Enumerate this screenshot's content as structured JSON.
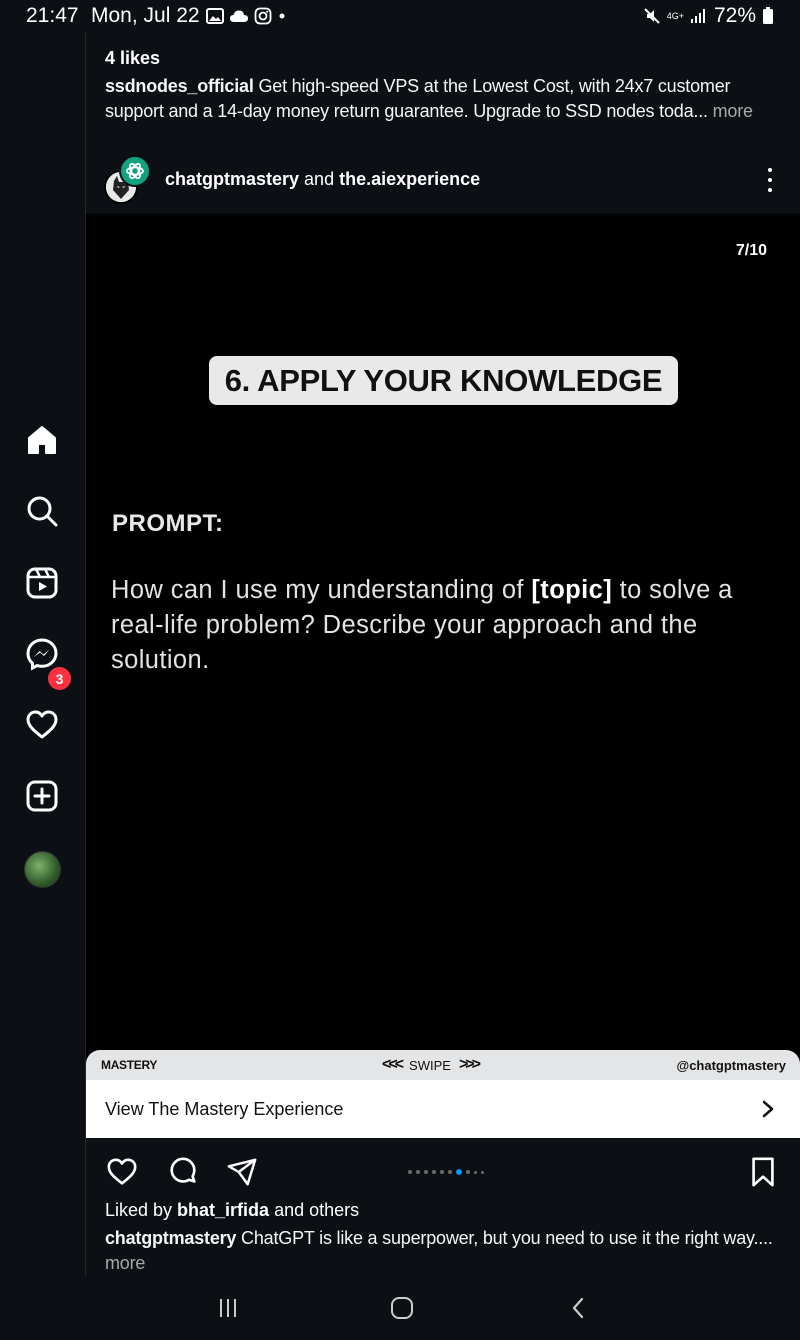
{
  "status_bar": {
    "time": "21:47",
    "date": "Mon, Jul 22",
    "network": "4G+",
    "battery": "72%"
  },
  "side_nav": {
    "items": [
      {
        "name": "home",
        "icon": "home-icon"
      },
      {
        "name": "search",
        "icon": "search-icon"
      },
      {
        "name": "reels",
        "icon": "reels-icon"
      },
      {
        "name": "messages",
        "icon": "messenger-icon"
      },
      {
        "name": "notifications",
        "icon": "heart-icon"
      },
      {
        "name": "create",
        "icon": "plus-square-icon"
      },
      {
        "name": "profile",
        "icon": "avatar"
      }
    ],
    "messages_badge": "3"
  },
  "previous_post": {
    "likes": "4 likes",
    "username": "ssdnodes_official",
    "caption": " Get high-speed VPS at the Lowest Cost, with 24x7 customer support and a 14-day money return guarantee. Upgrade to SSD nodes toda...",
    "more": " more"
  },
  "post": {
    "author": "chatgptmastery",
    "joiner": " and ",
    "coauthor": "the.aiexperience",
    "slide_counter": "7/10",
    "slide": {
      "heading": "6. APPLY YOUR KNOWLEDGE",
      "prompt_label": "PROMPT:",
      "prompt_before": "How can I use my understanding of ",
      "prompt_bold": "[topic]",
      "prompt_after": " to solve a real-life problem? Describe your approach and the solution.",
      "brand_left": "MASTERY",
      "brand_mid": "SWIPE",
      "brand_right": "@chatgptmastery"
    },
    "cta": "View The Mastery Experience",
    "carousel": {
      "count": 10,
      "active_index": 6
    },
    "liked_by_prefix": "Liked by ",
    "liked_by_user": "bhat_irfida",
    "liked_by_suffix": " and others",
    "caption_user": "chatgptmastery",
    "caption_text": " ChatGPT is like a superpower, but you need to use it the right way....",
    "caption_more": "more"
  },
  "colors": {
    "background": "#0c1014",
    "badge": "#ff3040",
    "carousel_active": "#0095f6"
  }
}
